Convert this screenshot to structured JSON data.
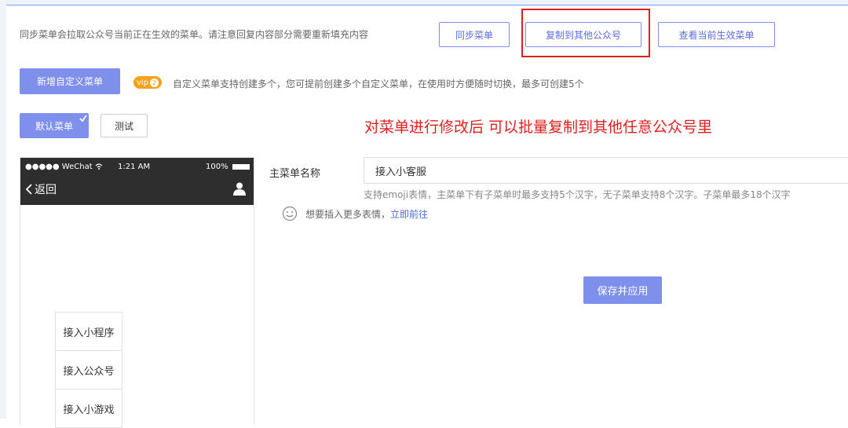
{
  "sync_bar": {
    "hint": "同步菜单会拉取公众号当前正在生效的菜单。请注意回复内容部分需要重新填充内容",
    "sync_button": "同步菜单",
    "copy_button": "复制到其他公众号",
    "view_active_button": "查看当前生效菜单"
  },
  "custom_menu": {
    "add_button": "新增自定义菜单",
    "vip_badge": "vip",
    "vip_level": "2",
    "hint": "自定义菜单支持创建多个，您可提前创建多个自定义菜单，在使用时方便随时切换，最多可创建5个"
  },
  "menu_tabs": {
    "default_label": "默认菜单",
    "test_label": "测试"
  },
  "annotation": "对菜单进行修改后 可以批量复制到其他任意公众号里",
  "phone": {
    "carrier": "●●●●● WeChat",
    "time": "1:21 AM",
    "battery": "100%",
    "back_label": "返回",
    "submenu_items": [
      "接入小程序",
      "接入公众号",
      "接入小游戏"
    ]
  },
  "editor": {
    "main_menu_label": "主菜单名称",
    "main_menu_value": "接入小客服",
    "help_text": "支持emoji表情，主菜单下有子菜单时最多支持5个汉字，无子菜单支持8个汉字。子菜单最多18个汉字",
    "emoji_hint": "想要插入更多表情，",
    "emoji_link": "立即前往",
    "save_button": "保存并应用"
  },
  "colors": {
    "accent": "#7f8fec",
    "accent_text": "#5b6ee1",
    "annotation_red": "#e02020",
    "phone_header": "#2e2e2e"
  },
  "icons": [
    "wifi-icon",
    "battery-icon",
    "chevron-left-icon",
    "person-icon",
    "smiley-icon",
    "check-icon"
  ]
}
